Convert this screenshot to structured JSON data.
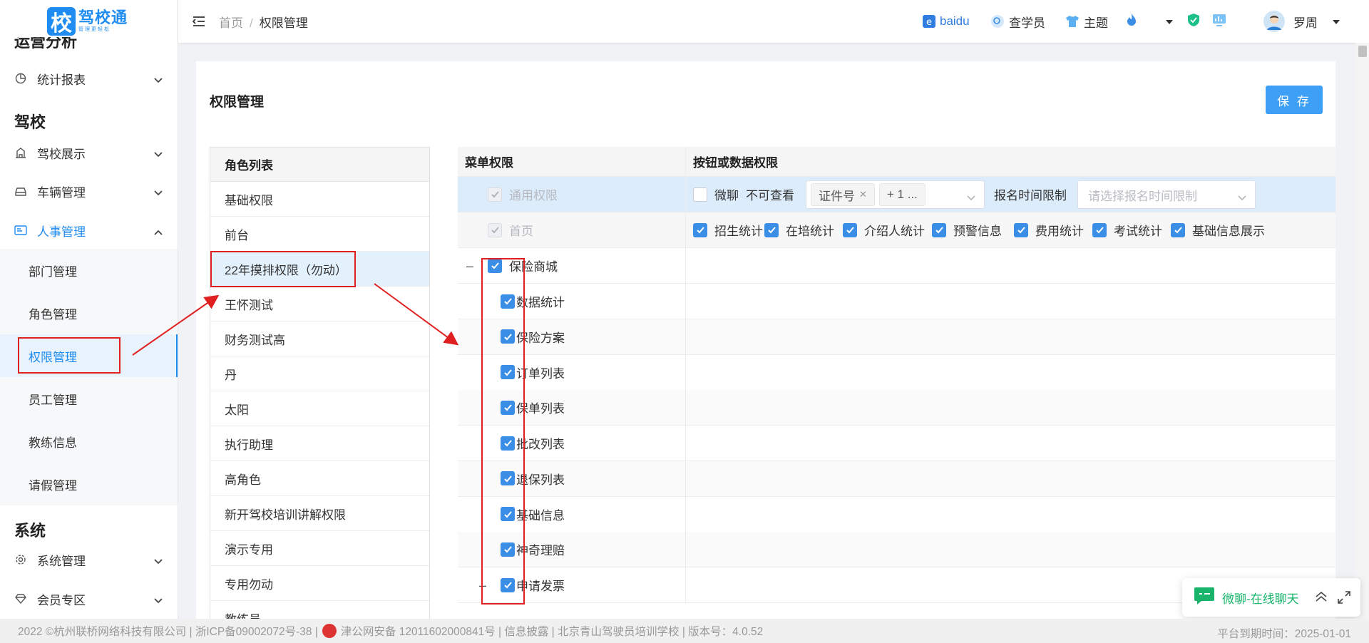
{
  "app": {
    "logo_glyph": "校",
    "logo_title": "驾校通",
    "logo_sub": "管理更轻松",
    "accent": "#1e8cf0"
  },
  "sidebar": {
    "section_partial": "运营分析",
    "stats": "统计报表",
    "section_school": "驾校",
    "school_show": "驾校展示",
    "vehicles": "车辆管理",
    "hr": "人事管理",
    "hr_items": [
      "部门管理",
      "角色管理",
      "权限管理",
      "员工管理",
      "教练信息",
      "请假管理"
    ],
    "section_system": "系统",
    "sys_mgmt": "系统管理",
    "member": "会员专区"
  },
  "header": {
    "breadcrumb_home": "首页",
    "breadcrumb_sep": "/",
    "breadcrumb_current": "权限管理",
    "baidu": "baidu",
    "student_lookup": "查学员",
    "theme": "主题",
    "user_name": "罗周"
  },
  "page": {
    "title": "权限管理",
    "save_label": "保 存"
  },
  "roles": {
    "header": "角色列表",
    "items": [
      "基础权限",
      "前台",
      "22年摸排权限（勿动）",
      "王怀测试",
      "财务测试高",
      "丹",
      "太阳",
      "执行助理",
      "高角色",
      "新开驾校培训讲解权限",
      "演示专用",
      "专用勿动",
      "教练员"
    ],
    "selected_index": 2
  },
  "perm": {
    "col_menu": "菜单权限",
    "col_buttons": "按钮或数据权限",
    "general": {
      "label": "通用权限",
      "wechat": "微聊",
      "cannot_view": "不可查看",
      "tag1": "证件号",
      "tag2": "+ 1 ...",
      "signup_limit": "报名时间限制",
      "signup_placeholder": "请选择报名时间限制"
    },
    "home": {
      "label": "首页",
      "buttons": [
        "招生统计",
        "在培统计",
        "介绍人统计",
        "预警信息",
        "费用统计",
        "考试统计",
        "基础信息展示"
      ]
    },
    "insurance": {
      "label": "保险商城",
      "children": [
        "数据统计",
        "保险方案",
        "订单列表",
        "保单列表",
        "批改列表",
        "退保列表",
        "基础信息",
        "神奇理赔"
      ]
    },
    "invoice": "申请发票"
  },
  "chat": {
    "label": "微聊-在线聊天"
  },
  "footer": {
    "left": "2022 ©杭州联桥网络科技有限公司 | 浙ICP备09002072号-38 |",
    "police": "津公网安备 12011602000841号 | 信息披露 | 北京青山驾驶员培训学校  | 版本号：4.0.52",
    "right": "平台到期时间：2025-01-01"
  }
}
